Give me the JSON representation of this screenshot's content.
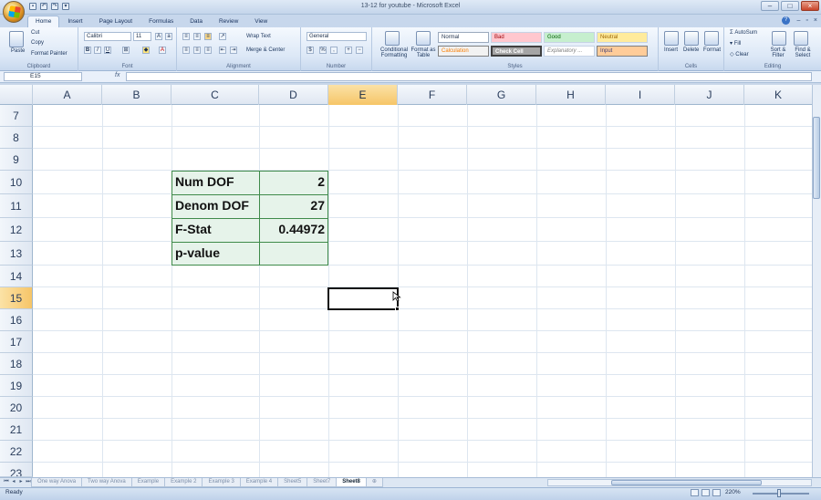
{
  "window": {
    "title": "13-12 for youtube - Microsoft Excel"
  },
  "qat": {
    "items": [
      "save-icon",
      "undo-icon",
      "redo-icon",
      "customize-icon"
    ]
  },
  "ribbon": {
    "tabs": [
      "Home",
      "Insert",
      "Page Layout",
      "Formulas",
      "Data",
      "Review",
      "View"
    ],
    "active_tab": "Home",
    "clipboard": {
      "paste": "Paste",
      "cut": "Cut",
      "copy": "Copy",
      "format_painter": "Format Painter",
      "label": "Clipboard"
    },
    "font": {
      "name": "Calibri",
      "size": "11",
      "label": "Font"
    },
    "alignment": {
      "wrap": "Wrap Text",
      "merge": "Merge & Center",
      "label": "Alignment"
    },
    "number": {
      "format": "General",
      "label": "Number"
    },
    "styles": {
      "conditional": "Conditional Formatting",
      "format_table": "Format as Table",
      "normal": "Normal",
      "bad": "Bad",
      "good": "Good",
      "neutral": "Neutral",
      "calculation": "Calculation",
      "check_cell": "Check Cell",
      "explanatory": "Explanatory ...",
      "input": "Input",
      "label": "Styles"
    },
    "cells": {
      "insert": "Insert",
      "delete": "Delete",
      "format": "Format",
      "label": "Cells"
    },
    "editing": {
      "autosum": "AutoSum",
      "fill": "Fill",
      "clear": "Clear",
      "sort": "Sort & Filter",
      "find": "Find & Select",
      "label": "Editing"
    }
  },
  "formula_bar": {
    "name_box": "E15",
    "fx": "fx",
    "content": ""
  },
  "grid": {
    "columns": [
      "A",
      "B",
      "C",
      "D",
      "E",
      "F",
      "G",
      "H",
      "I",
      "J",
      "K"
    ],
    "selected_column": "E",
    "rows": [
      "7",
      "8",
      "9",
      "10",
      "11",
      "12",
      "13",
      "14",
      "15",
      "16",
      "17",
      "18",
      "19",
      "20",
      "21",
      "22",
      "23"
    ],
    "selected_row": "15",
    "active_cell": "E15",
    "table": [
      {
        "label": "Num DOF",
        "value": "2"
      },
      {
        "label": "Denom DOF",
        "value": "27"
      },
      {
        "label": "F-Stat",
        "value": "0.44972"
      },
      {
        "label": "p-value",
        "value": ""
      }
    ]
  },
  "sheets": {
    "tabs": [
      "One way Anova",
      "Two way Anova",
      "Example",
      "Example 2",
      "Example 3",
      "Example 4",
      "Sheet5",
      "Sheet7",
      "Sheet8"
    ],
    "active": "Sheet8"
  },
  "status": {
    "ready": "Ready",
    "zoom": "220%"
  }
}
